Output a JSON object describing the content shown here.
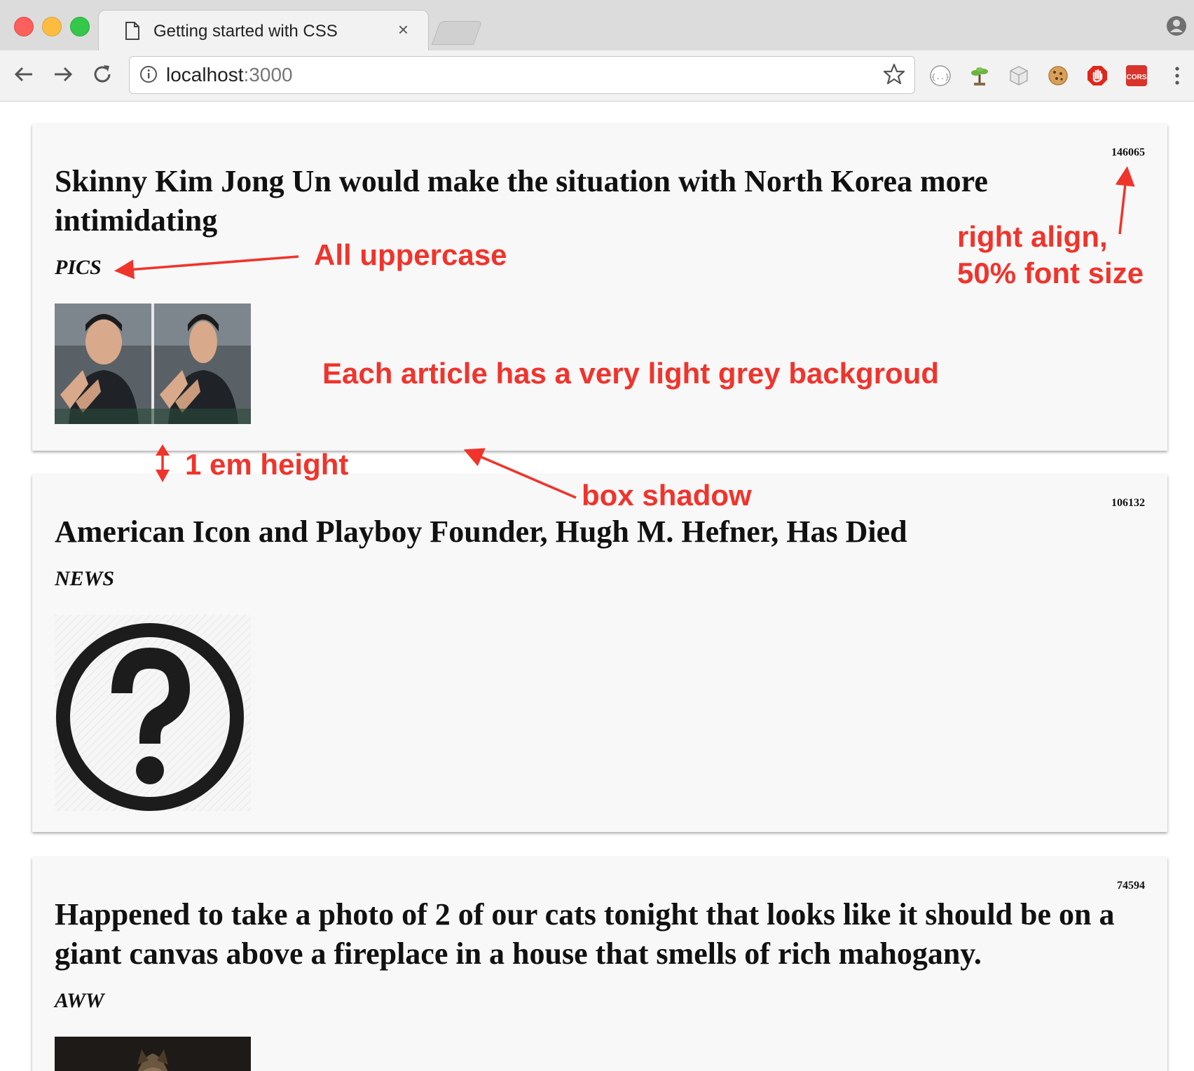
{
  "browser": {
    "tab_title": "Getting started with CSS",
    "tab_close": "×",
    "url_host": "localhost",
    "url_port": ":3000",
    "icons": [
      "document-icon",
      "close-icon",
      "back-icon",
      "forward-icon",
      "reload-icon",
      "info-icon",
      "star-icon",
      "profile-icon"
    ],
    "extensions": [
      "json-formatter-icon",
      "bonsai-icon",
      "cube-icon",
      "cookie-icon",
      "stop-hand-icon",
      "cors-icon"
    ],
    "cors_label": "CORS"
  },
  "articles": [
    {
      "score": "146065",
      "title": "Skinny Kim Jong Un would make the situation with North Korea more intimidating",
      "subreddit": "PICS"
    },
    {
      "score": "106132",
      "title": "American Icon and Playboy Founder, Hugh M. Hefner, Has Died",
      "subreddit": "NEWS"
    },
    {
      "score": "74594",
      "title": "Happened to take a photo of 2 of our cats tonight that looks like it should be on a giant canvas above a fireplace in a house that smells of rich mahogany.",
      "subreddit": "AWW"
    }
  ],
  "annotations": {
    "uppercase": "All uppercase",
    "right_align_1": "right align,",
    "right_align_2": "50% font size",
    "background": "Each article has a very light grey backgroud",
    "em_height": "1 em height",
    "box_shadow": "box shadow"
  },
  "colors": {
    "annotation": "#f0342c",
    "article_background": "#f8f8f8"
  }
}
